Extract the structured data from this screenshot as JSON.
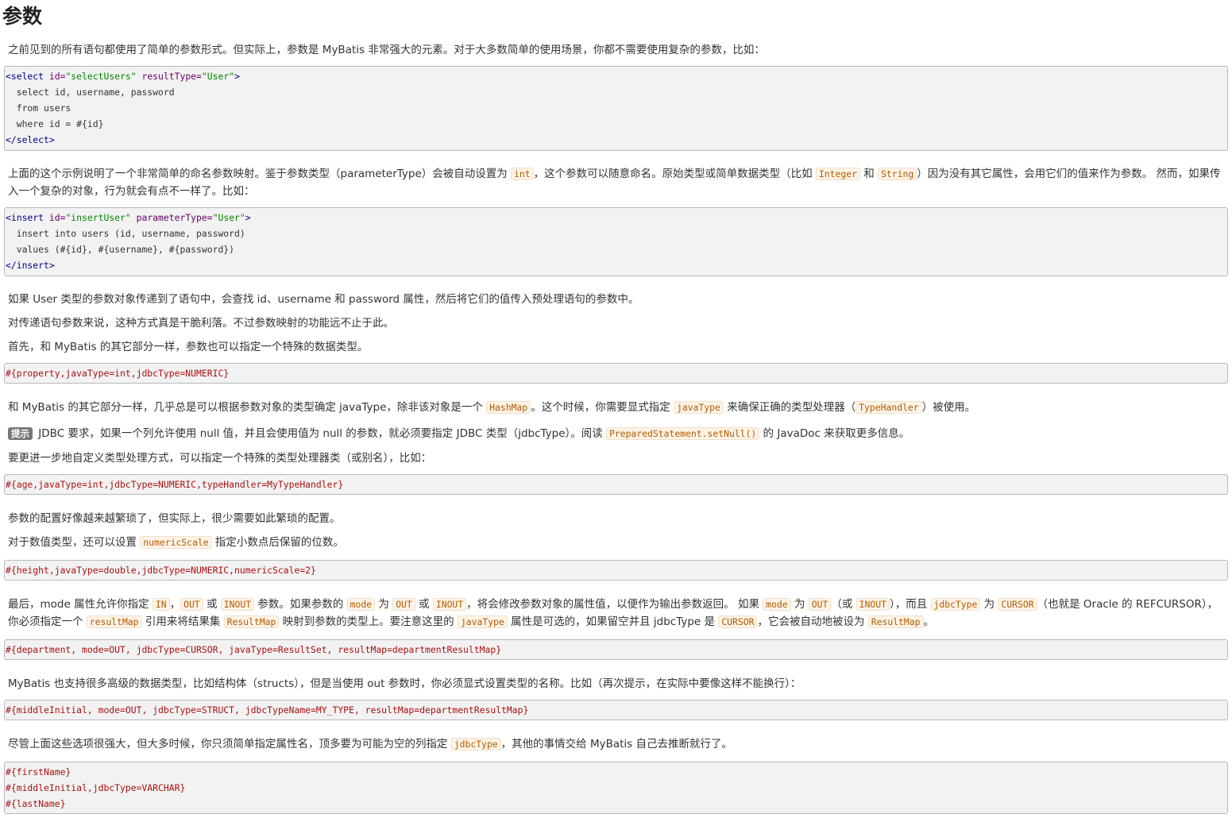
{
  "title": "参数",
  "p1": "之前见到的所有语句都使用了简单的参数形式。但实际上，参数是 MyBatis 非常强大的元素。对于大多数简单的使用场景，你都不需要使用复杂的参数，比如：",
  "code1": {
    "l1_tag_open": "<select ",
    "l1_attr1": "id=",
    "l1_val1": "\"selectUsers\"",
    "l1_attr2": " resultType=",
    "l1_val2": "\"User\"",
    "l1_close": ">",
    "l2": "  select id, username, password",
    "l3": "  from users",
    "l4": "  where id = #{id}",
    "l5": "</select>"
  },
  "p2": {
    "t1": "上面的这个示例说明了一个非常简单的命名参数映射。鉴于参数类型（parameterType）会被自动设置为 ",
    "c1": "int",
    "t2": "，这个参数可以随意命名。原始类型或简单数据类型（比如 ",
    "c2": "Integer",
    "t3": " 和 ",
    "c3": "String",
    "t4": "）因为没有其它属性，会用它们的值来作为参数。 然而，如果传入一个复杂的对象，行为就会有点不一样了。比如："
  },
  "code2": {
    "l1_tag_open": "<insert ",
    "l1_attr1": "id=",
    "l1_val1": "\"insertUser\"",
    "l1_attr2": " parameterType=",
    "l1_val2": "\"User\"",
    "l1_close": ">",
    "l2": "  insert into users (id, username, password)",
    "l3": "  values (#{id}, #{username}, #{password})",
    "l4": "</insert>"
  },
  "p3": "如果 User 类型的参数对象传递到了语句中，会查找 id、username 和 password 属性，然后将它们的值传入预处理语句的参数中。",
  "p4": "对传递语句参数来说，这种方式真是干脆利落。不过参数映射的功能远不止于此。",
  "p5": "首先，和 MyBatis 的其它部分一样，参数也可以指定一个特殊的数据类型。",
  "code3": "#{property,javaType=int,jdbcType=NUMERIC}",
  "p6": {
    "t1": "和 MyBatis 的其它部分一样，几乎总是可以根据参数对象的类型确定 javaType，除非该对象是一个 ",
    "c1": "HashMap",
    "t2": "。这个时候，你需要显式指定 ",
    "c2": "javaType",
    "t3": " 来确保正确的类型处理器（",
    "c3": "TypeHandler",
    "t4": "）被使用。"
  },
  "p7": {
    "badge": "提示",
    "t1": " JDBC 要求，如果一个列允许使用 null 值，并且会使用值为 null 的参数，就必须要指定 JDBC 类型（jdbcType）。阅读 ",
    "c1": "PreparedStatement.setNull()",
    "t2": " 的 JavaDoc 来获取更多信息。"
  },
  "p8": "要更进一步地自定义类型处理方式，可以指定一个特殊的类型处理器类（或别名），比如：",
  "code4": "#{age,javaType=int,jdbcType=NUMERIC,typeHandler=MyTypeHandler}",
  "p9": "参数的配置好像越来越繁琐了，但实际上，很少需要如此繁琐的配置。",
  "p10": {
    "t1": "对于数值类型，还可以设置 ",
    "c1": "numericScale",
    "t2": " 指定小数点后保留的位数。"
  },
  "code5": "#{height,javaType=double,jdbcType=NUMERIC,numericScale=2}",
  "p11": {
    "t1": "最后，mode 属性允许你指定 ",
    "c1": "IN",
    "t2": "，",
    "c2": "OUT",
    "t3": " 或 ",
    "c3": "INOUT",
    "t4": " 参数。如果参数的 ",
    "c4": "mode",
    "t5": " 为 ",
    "c5": "OUT",
    "t6": " 或 ",
    "c6": "INOUT",
    "t7": "，将会修改参数对象的属性值，以便作为输出参数返回。 如果 ",
    "c7": "mode",
    "t8": " 为 ",
    "c8": "OUT",
    "t9": "（或 ",
    "c9": "INOUT",
    "t10": "），而且 ",
    "c10": "jdbcType",
    "t11": " 为 ",
    "c11": "CURSOR",
    "t12": "（也就是 Oracle 的 REFCURSOR），你必须指定一个 ",
    "c12": "resultMap",
    "t13": " 引用来将结果集 ",
    "c13": "ResultMap",
    "t14": " 映射到参数的类型上。要注意这里的 ",
    "c14": "javaType",
    "t15": " 属性是可选的，如果留空并且 jdbcType 是 ",
    "c15": "CURSOR",
    "t16": "，它会被自动地被设为 ",
    "c16": "ResultMap",
    "t17": "。"
  },
  "code6": "#{department, mode=OUT, jdbcType=CURSOR, javaType=ResultSet, resultMap=departmentResultMap}",
  "p12": "MyBatis 也支持很多高级的数据类型，比如结构体（structs），但是当使用 out 参数时，你必须显式设置类型的名称。比如（再次提示，在实际中要像这样不能换行）：",
  "code7": "#{middleInitial, mode=OUT, jdbcType=STRUCT, jdbcTypeName=MY_TYPE, resultMap=departmentResultMap}",
  "p13": {
    "t1": "尽管上面这些选项很强大，但大多时候，你只须简单指定属性名，顶多要为可能为空的列指定 ",
    "c1": "jdbcType",
    "t2": "，其他的事情交给 MyBatis 自己去推断就行了。"
  },
  "code8": {
    "l1": "#{firstName}",
    "l2": "#{middleInitial,jdbcType=VARCHAR}",
    "l3": "#{lastName}"
  }
}
